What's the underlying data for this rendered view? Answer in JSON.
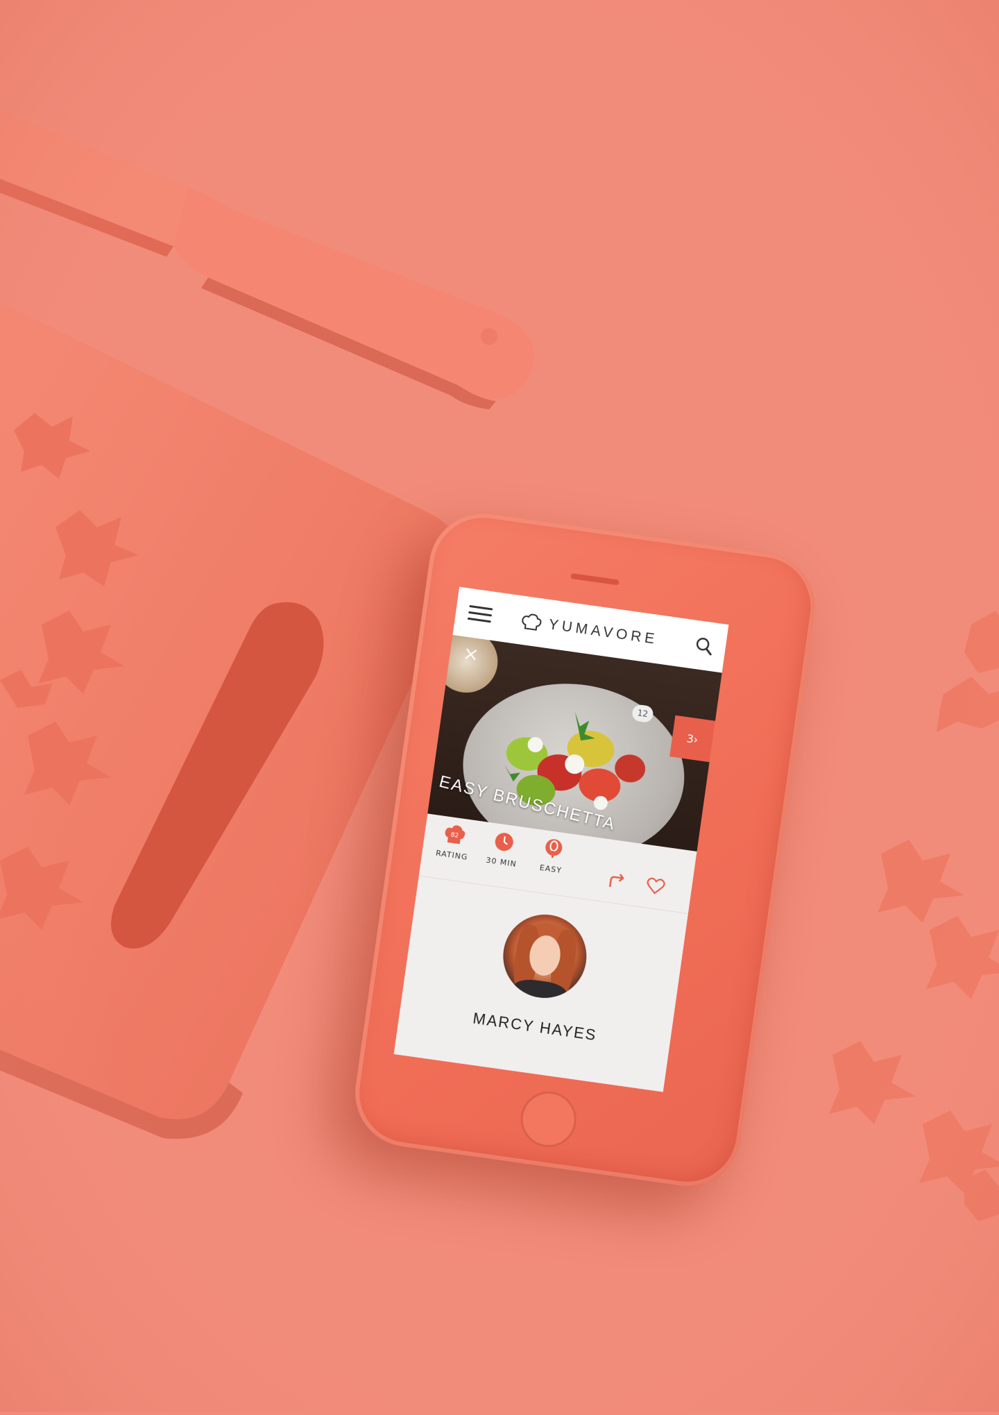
{
  "app": {
    "brand": "YUMAVORE"
  },
  "recipe": {
    "title": "EASY BRUSCHETTA",
    "comment_count": "12",
    "next_label": "3›",
    "rating_value": "82",
    "rating_label": "RATING",
    "time_label": "30 MIN",
    "difficulty_label": "EASY"
  },
  "author": {
    "name": "MARCY HAYES"
  },
  "colors": {
    "background": "#f28c7a",
    "phone": "#f06d56",
    "accent": "#e8604b",
    "screen_bg": "#f1eeee"
  },
  "icons": {
    "menu": "menu-icon",
    "search": "search-icon",
    "close": "close-icon",
    "chef_hat": "chef-hat-icon",
    "clock": "clock-icon",
    "whisk": "whisk-icon",
    "share": "share-icon",
    "heart": "heart-icon"
  }
}
